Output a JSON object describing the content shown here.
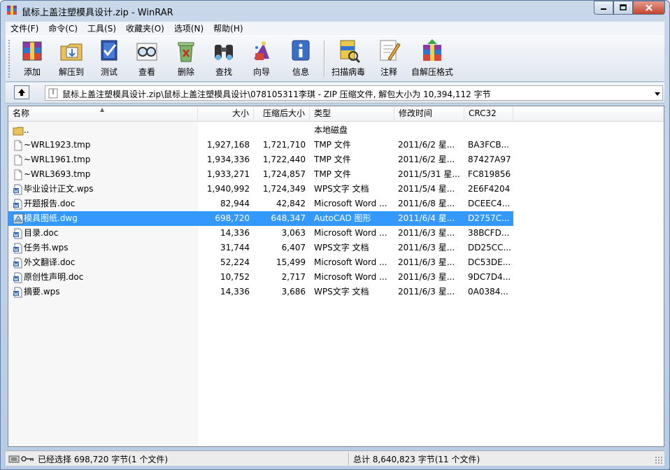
{
  "window": {
    "title": "鼠标上盖注塑模具设计.zip - WinRAR",
    "icon": "winrar-icon"
  },
  "menu": [
    "文件(F)",
    "命令(C)",
    "工具(S)",
    "收藏夹(O)",
    "选项(N)",
    "帮助(H)"
  ],
  "toolbar": {
    "add": "添加",
    "extract_to": "解压到",
    "test": "测试",
    "view": "查看",
    "delete": "删除",
    "find": "查找",
    "wizard": "向导",
    "info": "信息",
    "virus_scan": "扫描病毒",
    "comment": "注释",
    "sfx": "自解压格式"
  },
  "address": {
    "path": "鼠标上盖注塑模具设计.zip\\鼠标上盖注塑模具设计\\078105311李琪 - ZIP 压缩文件, 解包大小为 10,394,112 字节"
  },
  "columns": {
    "name": "名称",
    "size": "大小",
    "packed": "压缩后大小",
    "type": "类型",
    "modified": "修改时间",
    "crc": "CRC32"
  },
  "files": [
    {
      "name": "..",
      "size": "",
      "packed": "",
      "type": "本地磁盘",
      "modified": "",
      "crc": "",
      "icon": "folder"
    },
    {
      "name": "~WRL1923.tmp",
      "size": "1,927,168",
      "packed": "1,721,710",
      "type": "TMP 文件",
      "modified": "2011/6/2 星...",
      "crc": "BA3FCB...",
      "icon": "blank"
    },
    {
      "name": "~WRL1961.tmp",
      "size": "1,934,336",
      "packed": "1,722,440",
      "type": "TMP 文件",
      "modified": "2011/6/2 星...",
      "crc": "87427A97",
      "icon": "blank"
    },
    {
      "name": "~WRL3693.tmp",
      "size": "1,933,271",
      "packed": "1,724,857",
      "type": "TMP 文件",
      "modified": "2011/5/31 星...",
      "crc": "FC819856",
      "icon": "blank"
    },
    {
      "name": "毕业设计正文.wps",
      "size": "1,940,992",
      "packed": "1,724,349",
      "type": "WPS文字 文档",
      "modified": "2011/5/4 星...",
      "crc": "2E6F4204",
      "icon": "doc"
    },
    {
      "name": "开题报告.doc",
      "size": "82,944",
      "packed": "42,842",
      "type": "Microsoft Word ...",
      "modified": "2011/6/8 星...",
      "crc": "DCEEC4...",
      "icon": "doc"
    },
    {
      "name": "模具图纸.dwg",
      "size": "698,720",
      "packed": "648,347",
      "type": "AutoCAD 图形",
      "modified": "2011/6/4 星...",
      "crc": "D2757C...",
      "icon": "dwg"
    },
    {
      "name": "目录.doc",
      "size": "14,336",
      "packed": "3,063",
      "type": "Microsoft Word ...",
      "modified": "2011/6/3 星...",
      "crc": "38BCFD...",
      "icon": "doc"
    },
    {
      "name": "任务书.wps",
      "size": "31,744",
      "packed": "6,407",
      "type": "WPS文字 文档",
      "modified": "2011/6/3 星...",
      "crc": "DD25CC...",
      "icon": "doc"
    },
    {
      "name": "外文翻译.doc",
      "size": "52,224",
      "packed": "15,499",
      "type": "Microsoft Word ...",
      "modified": "2011/6/3 星...",
      "crc": "DC53DE...",
      "icon": "doc"
    },
    {
      "name": "原创性声明.doc",
      "size": "10,752",
      "packed": "2,717",
      "type": "Microsoft Word ...",
      "modified": "2011/6/3 星...",
      "crc": "9DC7D4...",
      "icon": "doc"
    },
    {
      "name": "摘要.wps",
      "size": "14,336",
      "packed": "3,686",
      "type": "WPS文字 文档",
      "modified": "2011/6/3 星...",
      "crc": "0A0384...",
      "icon": "doc"
    }
  ],
  "selected_index": 6,
  "status": {
    "left": "已经选择 698,720 字节(1 个文件)",
    "right": "总计 8,640,823 字节(11 个文件)"
  },
  "colors": {
    "selection": "#3399ff",
    "window_frame": "#b9cde5",
    "close_button": "#c7503a"
  }
}
